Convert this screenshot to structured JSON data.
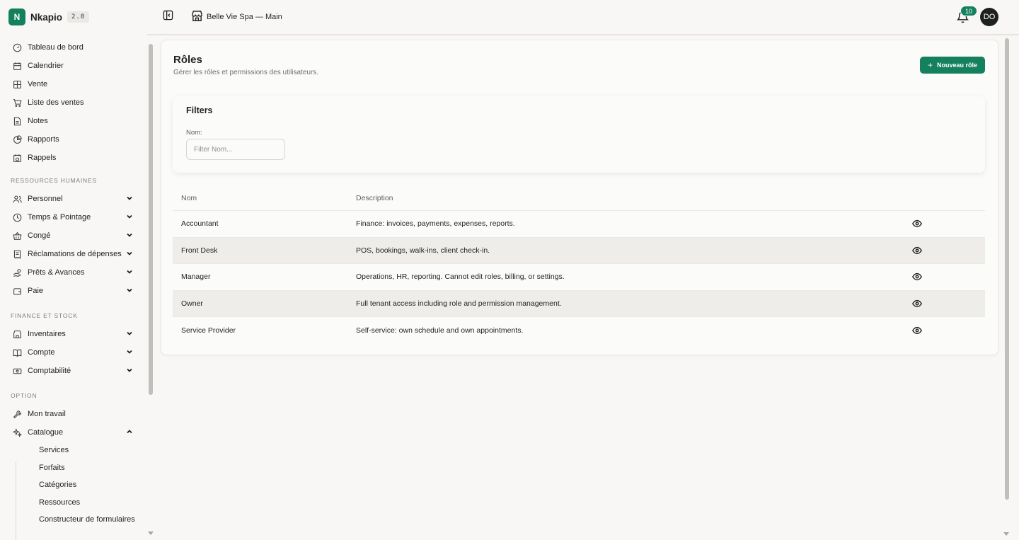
{
  "brand": {
    "initial": "N",
    "name": "Nkapio",
    "version": "2.0"
  },
  "sidebar": {
    "items_main": [
      {
        "label": "Tableau de bord",
        "icon": "gauge-icon"
      },
      {
        "label": "Calendrier",
        "icon": "calendar-icon"
      },
      {
        "label": "Vente",
        "icon": "grid-icon"
      },
      {
        "label": "Liste des ventes",
        "icon": "cart-icon"
      },
      {
        "label": "Notes",
        "icon": "file-icon"
      },
      {
        "label": "Rapports",
        "icon": "pie-chart-icon"
      },
      {
        "label": "Rappels",
        "icon": "calendar-clock-icon"
      }
    ],
    "section_hr": "RESSOURCES HUMAINES",
    "items_hr": [
      {
        "label": "Personnel",
        "icon": "users-icon"
      },
      {
        "label": "Temps & Pointage",
        "icon": "clock-icon"
      },
      {
        "label": "Congé",
        "icon": "basket-icon"
      },
      {
        "label": "Réclamations de dépenses",
        "icon": "receipt-icon"
      },
      {
        "label": "Prêts & Avances",
        "icon": "hand-coins-icon"
      },
      {
        "label": "Paie",
        "icon": "wallet-icon"
      }
    ],
    "section_finance": "FINANCE ET STOCK",
    "items_finance": [
      {
        "label": "Inventaires",
        "icon": "store-icon"
      },
      {
        "label": "Compte",
        "icon": "book-icon"
      },
      {
        "label": "Comptabilité",
        "icon": "banknote-icon"
      }
    ],
    "section_option": "OPTION",
    "items_option": [
      {
        "label": "Mon travail",
        "icon": "wrench-icon"
      },
      {
        "label": "Catalogue",
        "icon": "sparkles-icon"
      }
    ],
    "catalogue_sub": [
      "Services",
      "Forfaits",
      "Catégories",
      "Ressources",
      "Constructeur de formulaires"
    ]
  },
  "topbar": {
    "store_name": "Belle Vie Spa — Main",
    "notifications": "10",
    "avatar": "DO"
  },
  "page": {
    "title": "Rôles",
    "subtitle": "Gérer les rôles et permissions des utilisateurs.",
    "new_button": "Nouveau rôle"
  },
  "filters": {
    "title": "Filters",
    "name_label": "Nom:",
    "name_placeholder": "Filter Nom..."
  },
  "table": {
    "headers": [
      "Nom",
      "Description"
    ],
    "rows": [
      {
        "name": "Accountant",
        "description": "Finance: invoices, payments, expenses, reports."
      },
      {
        "name": "Front Desk",
        "description": "POS, bookings, walk-ins, client check-in."
      },
      {
        "name": "Manager",
        "description": "Operations, HR, reporting. Cannot edit roles, billing, or settings."
      },
      {
        "name": "Owner",
        "description": "Full tenant access including role and permission management."
      },
      {
        "name": "Service Provider",
        "description": "Self-service: own schedule and own appointments."
      }
    ]
  },
  "colors": {
    "accent": "#14805e",
    "background": "#f8f7f5"
  }
}
